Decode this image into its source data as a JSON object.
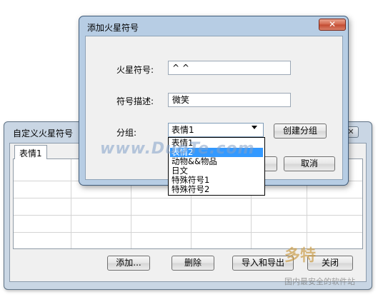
{
  "background_window": {
    "title": "自定义火星符号",
    "close_glyph": "✕",
    "tab_label": "表情1",
    "buttons": {
      "add": "添加...",
      "delete": "删除",
      "import_export": "导入和导出",
      "close": "关闭"
    }
  },
  "dialog": {
    "title": "添加火星符号",
    "close_glyph": "✕",
    "symbol_label": "火星符号:",
    "symbol_value": "^ ^",
    "desc_label": "符号描述:",
    "desc_value": "微笑",
    "group_label": "分组:",
    "group_selected": "表情1",
    "create_group_button": "创建分组",
    "ok_button": "",
    "cancel_button": "取消",
    "group_options": [
      "表情1",
      "表情2",
      "动物&&物品",
      "日文",
      "特殊符号1",
      "特殊符号2"
    ],
    "highlighted_option_index": 1
  },
  "overlays": {
    "watermark": "www.DuoTe.com",
    "corner_logo": "多特",
    "corner_sub": "国内最安全的软件站"
  },
  "colors": {
    "dialog_frame": "#b7cde4",
    "background_frame": "#c9d6e4",
    "close_button": "#c24a30",
    "selection": "#3399ff"
  }
}
